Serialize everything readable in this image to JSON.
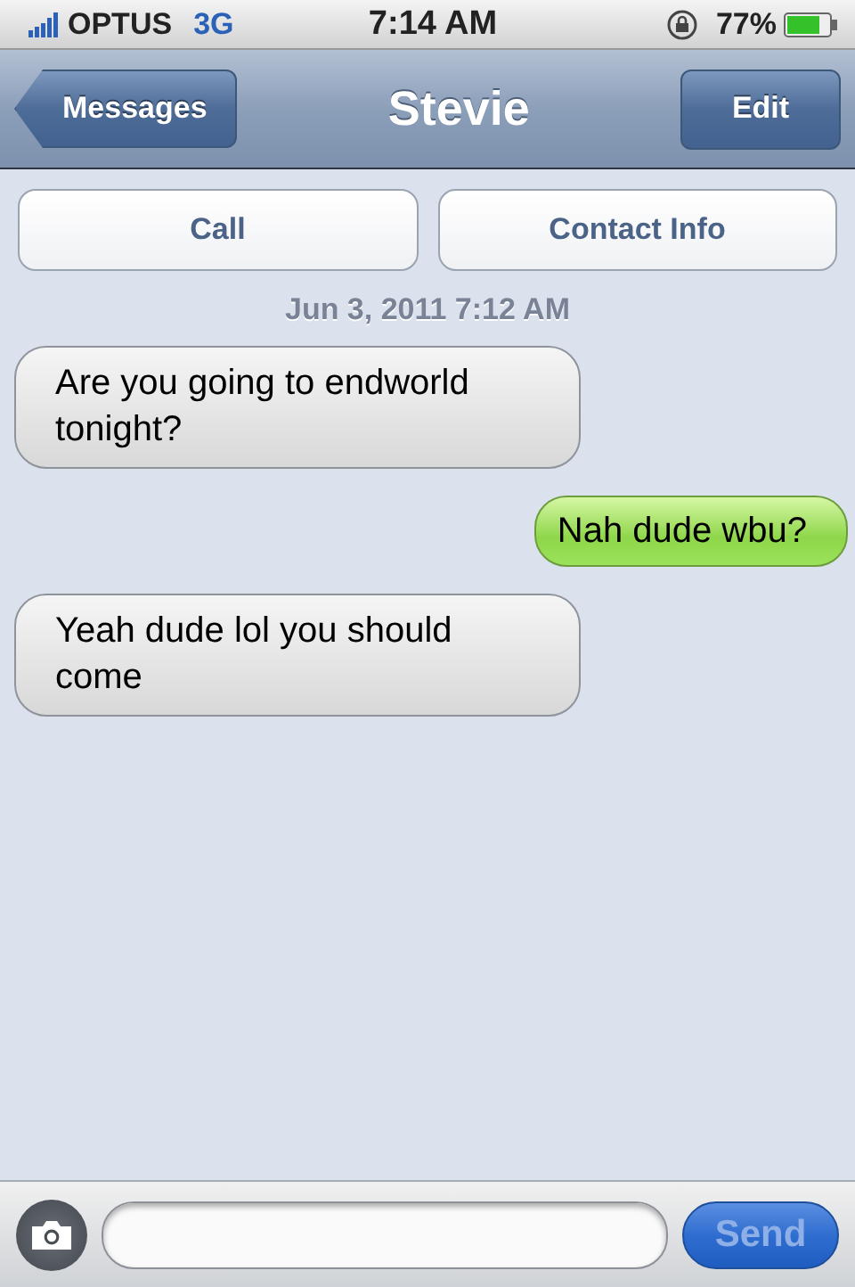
{
  "status_bar": {
    "carrier": "OPTUS",
    "network": "3G",
    "time": "7:14 AM",
    "battery": "77%"
  },
  "nav_bar": {
    "back_button": "Messages",
    "title": "Stevie",
    "edit_button": "Edit"
  },
  "actions": [
    {
      "label": "Call"
    },
    {
      "label": "Contact Info"
    }
  ],
  "timestamp": "Jun 3, 2011 7:12 AM",
  "messages": [
    {
      "kind": "received",
      "text": "Are you going to endworld tonight?"
    },
    {
      "kind": "sent",
      "text": "Nah dude wbu?"
    },
    {
      "kind": "received",
      "text": "Yeah dude lol you should come"
    }
  ],
  "compose": {
    "send_button": "Send",
    "send_disabled": true
  }
}
